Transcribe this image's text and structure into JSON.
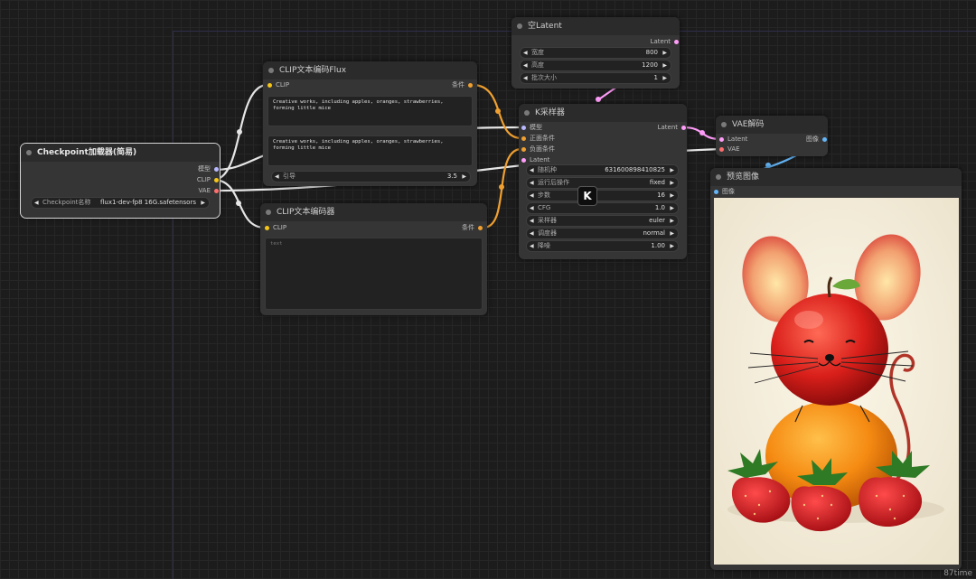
{
  "colors": {
    "clip": "#f5c518",
    "conditioning": "#f0a030",
    "model": "#b8b8ff",
    "vae": "#ff6e6e",
    "latent": "#ff9cf9",
    "image": "#64b5f6",
    "link_white": "#e6e6e6"
  },
  "checkpoint_node": {
    "title": "Checkpoint加载器(简易)",
    "outputs": {
      "model": "模型",
      "clip": "CLIP",
      "vae": "VAE"
    },
    "ckpt_label": "Checkpoint名称",
    "ckpt_value": "flux1-dev-fp8 16G.safetensors"
  },
  "clip_flux_node": {
    "title": "CLIP文本编码Flux",
    "input_clip": "CLIP",
    "output_cond": "条件",
    "text1": "Creative works, including apples, oranges, strawberries, forming little mice",
    "text2": "Creative works, including apples, oranges, strawberries, forming little mice",
    "guidance_label": "引导",
    "guidance_value": "3.5"
  },
  "clip_node": {
    "title": "CLIP文本编码器",
    "input_clip": "CLIP",
    "output_cond": "条件",
    "text": "text"
  },
  "empty_latent_node": {
    "title": "空Latent",
    "output": "Latent",
    "width_label": "宽度",
    "width_value": "800",
    "height_label": "高度",
    "height_value": "1200",
    "batch_label": "批次大小",
    "batch_value": "1"
  },
  "ksampler_node": {
    "title": "K采样器",
    "inputs": {
      "model": "模型",
      "positive": "正面条件",
      "negative": "负面条件",
      "latent": "Latent"
    },
    "output": "Latent",
    "seed_label": "随机种",
    "seed_value": "631600898410825",
    "control_label": "运行后操作",
    "control_value": "fixed",
    "steps_label": "步数",
    "steps_value": "16",
    "cfg_label": "CFG",
    "cfg_value": "1.0",
    "sampler_label": "采样器",
    "sampler_value": "euler",
    "scheduler_label": "调度器",
    "scheduler_value": "normal",
    "denoise_label": "降噪",
    "denoise_value": "1.00",
    "overlay_icon": "K"
  },
  "vae_decode_node": {
    "title": "VAE解码",
    "inputs": {
      "samples": "Latent",
      "vae": "VAE"
    },
    "output": "图像"
  },
  "preview_node": {
    "title": "预览图像",
    "input": "图像"
  },
  "footer": {
    "time": "87time"
  }
}
